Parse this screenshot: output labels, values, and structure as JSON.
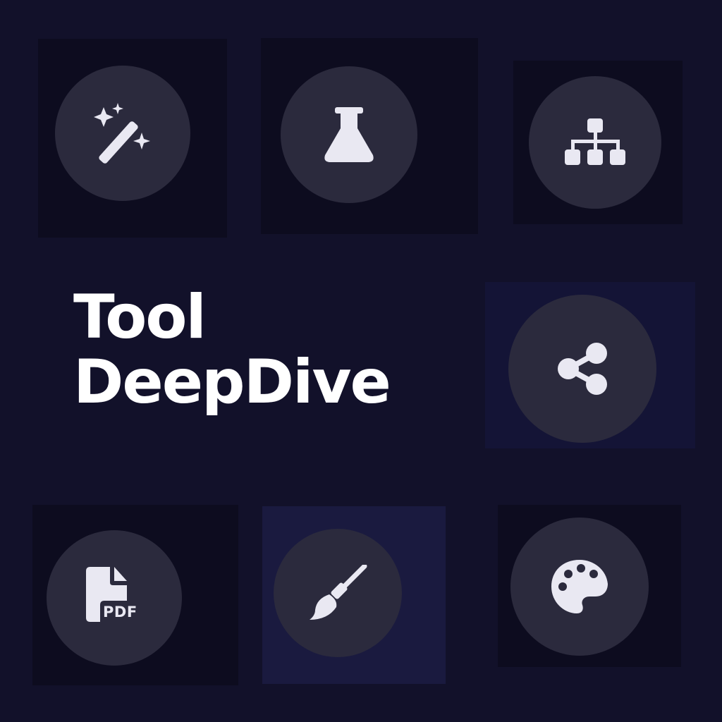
{
  "title": {
    "line1": "Tool",
    "line2": "DeepDive"
  },
  "colors": {
    "background": "#12112a",
    "circle": "#2b2a3d",
    "icon": "#e9e8f2",
    "title": "#ffffff"
  },
  "tiles": [
    {
      "icon": "magic-wand-icon"
    },
    {
      "icon": "flask-icon"
    },
    {
      "icon": "sitemap-icon"
    },
    {
      "icon": "share-icon"
    },
    {
      "icon": "file-pdf-icon",
      "label": "PDF"
    },
    {
      "icon": "broom-icon"
    },
    {
      "icon": "palette-icon"
    }
  ]
}
